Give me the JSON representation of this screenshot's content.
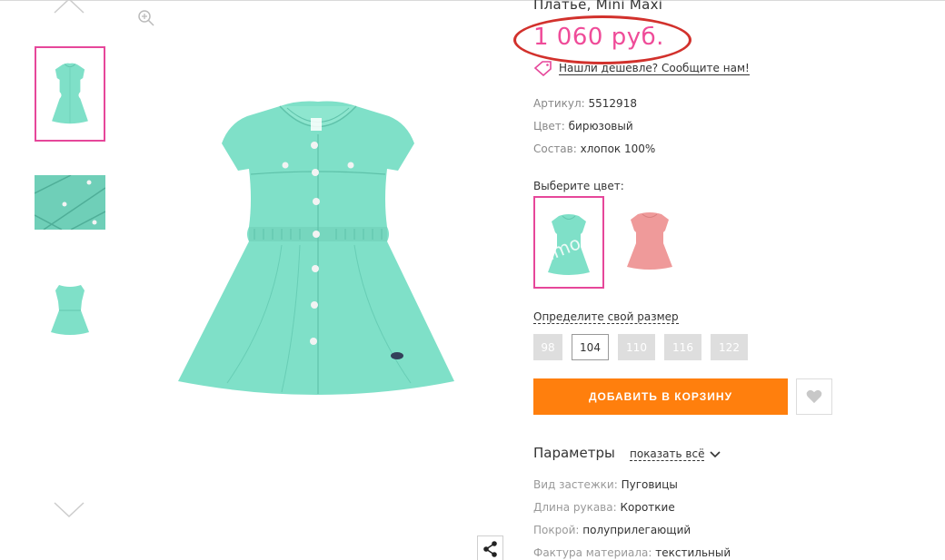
{
  "product": {
    "title": "Платье, Mini Maxi",
    "price": "1 060 руб.",
    "cheaper_link": "Нашли дешевле? Сообщите нам!"
  },
  "attributes": [
    {
      "key": "Артикул:",
      "value": "5512918"
    },
    {
      "key": "Цвет:",
      "value": "бирюзовый"
    },
    {
      "key": "Состав:",
      "value": "хлопок 100%"
    }
  ],
  "color_picker": {
    "label": "Выберите цвет:",
    "options": [
      {
        "name": "бирюзовый",
        "color": "#7fe0c8",
        "selected": true
      },
      {
        "name": "розовый",
        "color": "#ef9a9a",
        "selected": false
      }
    ],
    "watermark": "lamo"
  },
  "sizes": {
    "link": "Определите свой размер",
    "options": [
      {
        "label": "98",
        "available": false
      },
      {
        "label": "104",
        "available": true,
        "selected": true
      },
      {
        "label": "110",
        "available": false
      },
      {
        "label": "116",
        "available": false
      },
      {
        "label": "122",
        "available": false
      }
    ]
  },
  "actions": {
    "add_to_cart": "ДОБАВИТЬ В КОРЗИНУ"
  },
  "params": {
    "title": "Параметры",
    "show_all": "показать всё",
    "items": [
      {
        "key": "Вид застежки:",
        "value": "Пуговицы"
      },
      {
        "key": "Длина рукава:",
        "value": "Короткие"
      },
      {
        "key": "Покрой:",
        "value": "полуприлегающий"
      },
      {
        "key": "Фактура материала:",
        "value": "текстильный"
      }
    ]
  },
  "icons": {
    "zoom": "zoom-in-icon",
    "share": "share-icon",
    "favorite": "heart-icon",
    "tag": "price-tag-icon",
    "arrow_up": "chevron-up-icon",
    "arrow_down": "chevron-down-icon"
  },
  "colors": {
    "dress": "#7fe0c8",
    "accent_pink": "#e6479a",
    "price_pink": "#ef4c99",
    "cta_orange": "#ff7f0d",
    "annotation_red": "#d2312c"
  }
}
